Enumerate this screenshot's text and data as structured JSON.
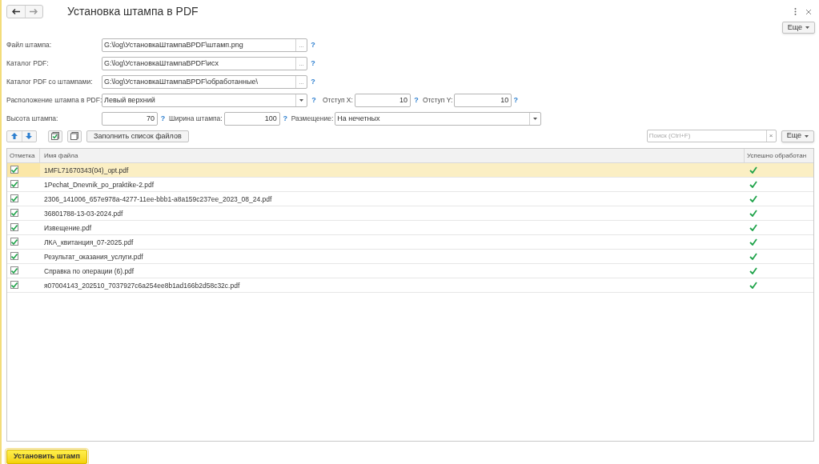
{
  "window": {
    "title": "Установка штампа в PDF"
  },
  "top_more_button": "Еще",
  "fields": [
    {
      "label": "Файл штампа:",
      "value": "G:\\log\\УстановкаШтампаВPDF\\штамп.png",
      "button": "...",
      "help": "?"
    },
    {
      "label": "Каталог PDF:",
      "value": "G:\\log\\УстановкаШтампаВPDF\\исх",
      "button": "...",
      "help": "?"
    },
    {
      "label": "Каталог PDF со штампами:",
      "value": "G:\\log\\УстановкаШтампаВPDF\\обработанные\\",
      "button": "...",
      "help": "?"
    }
  ],
  "position_row": {
    "label": "Расположение штампа в PDF:",
    "value": "Левый верхний",
    "help": "?",
    "offset_x": {
      "label": "Отступ X:",
      "value": "10",
      "help": "?"
    },
    "offset_y": {
      "label": "Отступ Y:",
      "value": "10",
      "help": "?"
    }
  },
  "size_row": {
    "height": {
      "label": "Высота штампа:",
      "value": "70",
      "help": "?"
    },
    "width": {
      "label": "Ширина штампа:",
      "value": "100",
      "help": "?"
    },
    "placement": {
      "label": "Размещение:",
      "value": "На нечетных"
    }
  },
  "toolbar": {
    "fill_button": "Заполнить список файлов",
    "search": {
      "placeholder": "Поиск (Ctrl+F)"
    },
    "clear": "×",
    "more_button": "Еще"
  },
  "table": {
    "columns": [
      "Отметка",
      "Имя файла",
      "Успешно обработан"
    ],
    "rows": [
      {
        "checked": true,
        "name": "1MFL71670343(04)_opt.pdf",
        "processed": true,
        "selected": true
      },
      {
        "checked": true,
        "name": "1Pechat_Dnevnik_po_praktike-2.pdf",
        "processed": true,
        "selected": false
      },
      {
        "checked": true,
        "name": "2306_141006_657e978a-4277-11ee-bbb1-a8a159c237ee_2023_08_24.pdf",
        "processed": true,
        "selected": false
      },
      {
        "checked": true,
        "name": "36801788-13-03-2024.pdf",
        "processed": true,
        "selected": false
      },
      {
        "checked": true,
        "name": "Извещение.pdf",
        "processed": true,
        "selected": false
      },
      {
        "checked": true,
        "name": "ЛКА_квитанция_07-2025.pdf",
        "processed": true,
        "selected": false
      },
      {
        "checked": true,
        "name": "Результат_оказания_услуги.pdf",
        "processed": true,
        "selected": false
      },
      {
        "checked": true,
        "name": "Справка по операции (6).pdf",
        "processed": true,
        "selected": false
      },
      {
        "checked": true,
        "name": "я07004143_202510_7037927c6a254ee8b1ad166b2d58c32c.pdf",
        "processed": true,
        "selected": false
      }
    ]
  },
  "footer_button": "Установить штамп"
}
